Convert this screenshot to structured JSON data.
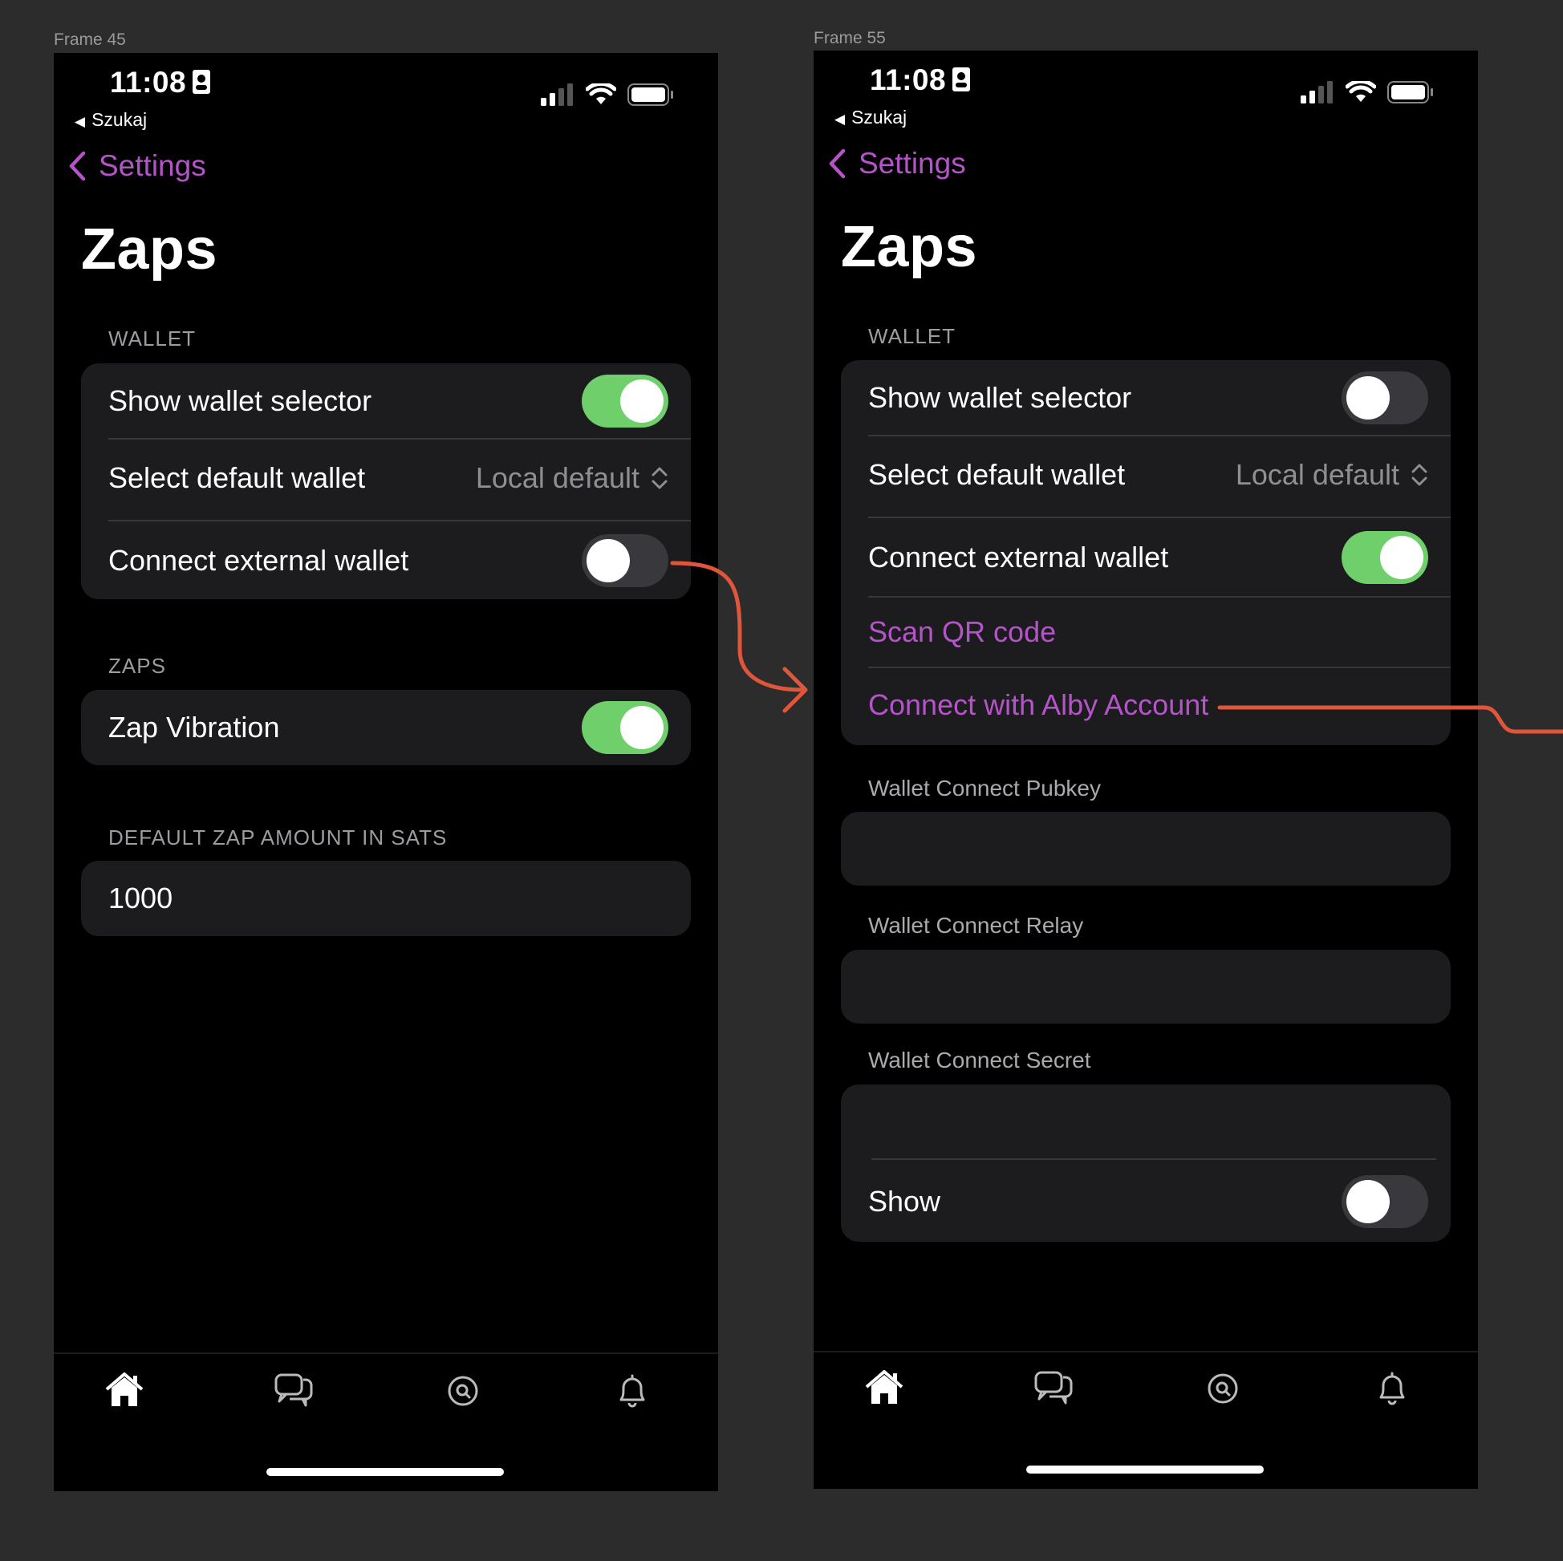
{
  "frames": [
    {
      "label": "Frame 45",
      "status": {
        "time": "11:08",
        "back": "Szukaj"
      },
      "nav": {
        "back_label": "Settings"
      },
      "title": "Zaps",
      "wallet_section": "WALLET",
      "wallet_rows": {
        "show_selector": "Show wallet selector",
        "show_selector_on": true,
        "default_wallet": "Select default wallet",
        "default_wallet_value": "Local default",
        "connect_external": "Connect external wallet",
        "connect_external_on": false
      },
      "zaps_section": "ZAPS",
      "zap_vibration": "Zap Vibration",
      "zap_vibration_on": true,
      "amount_section": "DEFAULT ZAP AMOUNT IN SATS",
      "amount_value": "1000"
    },
    {
      "label": "Frame 55",
      "status": {
        "time": "11:08",
        "back": "Szukaj"
      },
      "nav": {
        "back_label": "Settings"
      },
      "title": "Zaps",
      "wallet_section": "WALLET",
      "wallet_rows": {
        "show_selector": "Show wallet selector",
        "show_selector_on": false,
        "default_wallet": "Select default wallet",
        "default_wallet_value": "Local default",
        "connect_external": "Connect external wallet",
        "connect_external_on": true,
        "scan_qr": "Scan QR code",
        "connect_alby": "Connect with Alby Account"
      },
      "pubkey_label": "Wallet Connect Pubkey",
      "relay_label": "Wallet Connect Relay",
      "secret_label": "Wallet Connect Secret",
      "show_label": "Show",
      "show_on": false
    }
  ],
  "tabs": [
    "home-icon",
    "chat-icon",
    "search-icon",
    "bell-icon"
  ],
  "colors": {
    "accent": "#b553c9",
    "toggle_on": "#6fcf6b",
    "arrow": "#e0563a"
  }
}
